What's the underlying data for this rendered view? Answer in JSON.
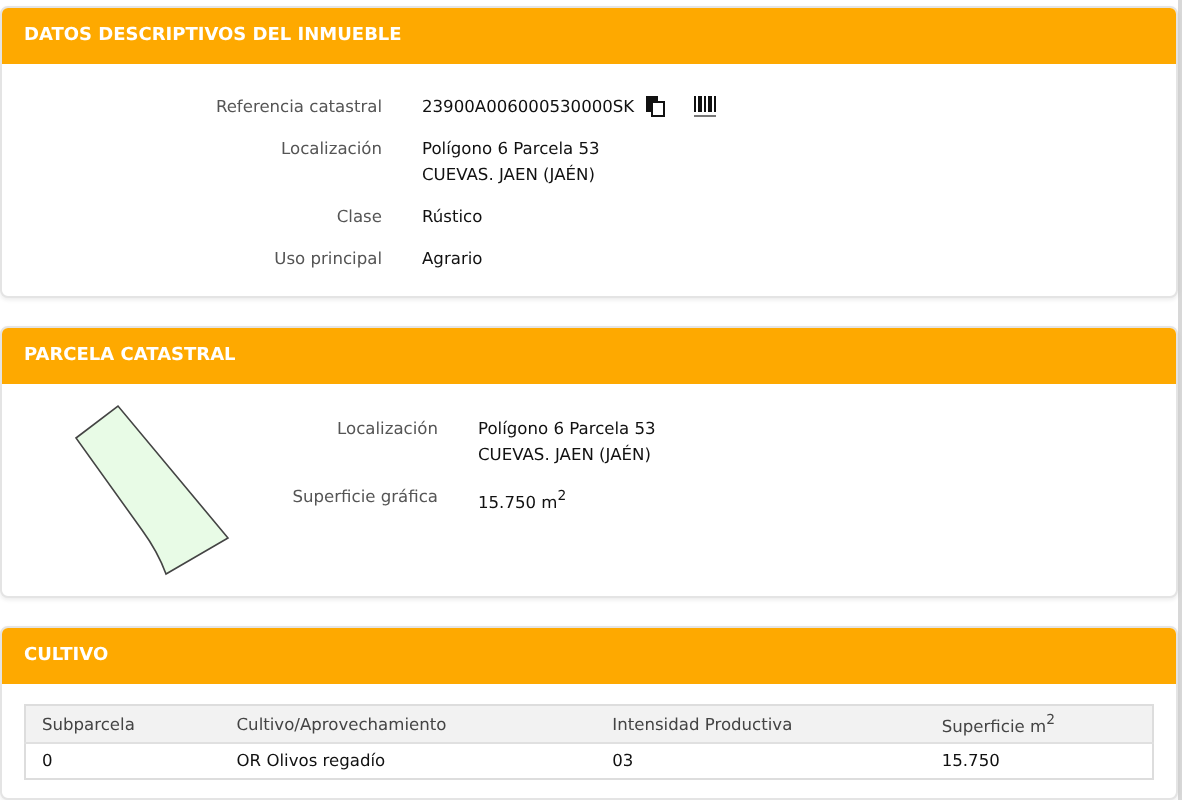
{
  "inmueble": {
    "title": "DATOS DESCRIPTIVOS DEL INMUEBLE",
    "fields": [
      {
        "label": "Referencia catastral",
        "lines": [
          "23900A006000530000SK"
        ],
        "actions": [
          {
            "kind": "copy"
          },
          {
            "kind": "barcode"
          }
        ]
      },
      {
        "label": "Localización",
        "lines": [
          "Polígono 6 Parcela 53",
          "CUEVAS. JAEN (JAÉN)"
        ]
      },
      {
        "label": "Clase",
        "lines": [
          "Rústico"
        ]
      },
      {
        "label": "Uso principal",
        "lines": [
          "Agrario"
        ]
      }
    ]
  },
  "parcela": {
    "title": "PARCELA CATASTRAL",
    "fields": [
      {
        "label": "Localización",
        "lines": [
          "Polígono 6 Parcela 53",
          "CUEVAS. JAEN (JAÉN)"
        ]
      },
      {
        "label": "Superficie gráfica",
        "lines": [
          "15.750 m$^{2}$"
        ]
      }
    ]
  },
  "cultivo": {
    "title": "CULTIVO",
    "table": {
      "columns": [
        "Subparcela",
        "Cultivo/Aprovechamiento",
        "Intensidad Productiva",
        "Superficie m$^{2}$"
      ],
      "rows": [
        [
          "0",
          "OR Olivos regadío",
          "03",
          "15.750"
        ]
      ]
    }
  }
}
